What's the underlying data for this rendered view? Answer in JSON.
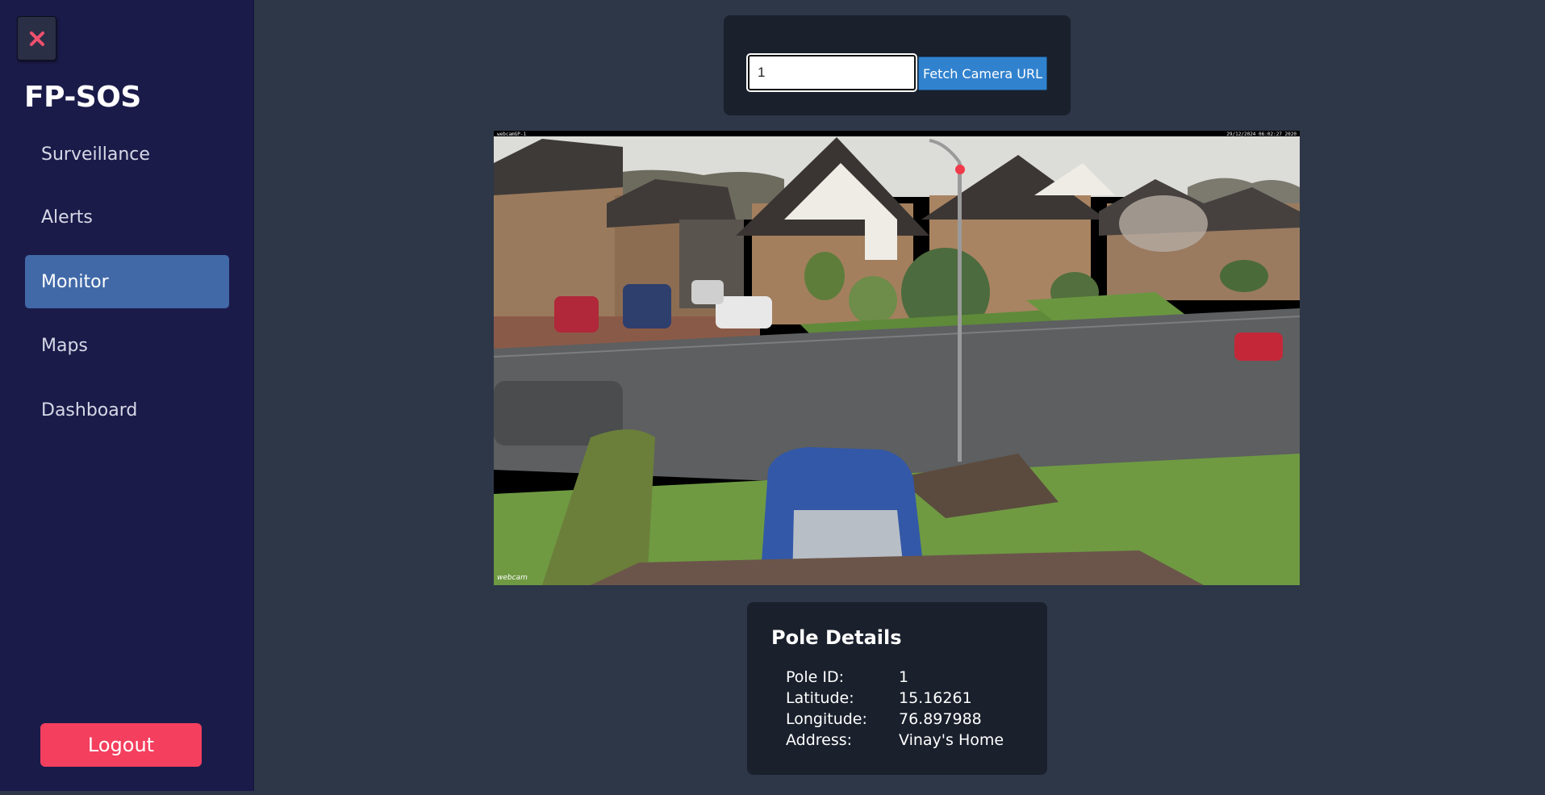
{
  "sidebar": {
    "close_icon": "close-icon",
    "brand": "FP-SOS",
    "items": [
      {
        "label": "Surveillance",
        "active": false
      },
      {
        "label": "Alerts",
        "active": false
      },
      {
        "label": "Monitor",
        "active": true
      },
      {
        "label": "Maps",
        "active": false
      },
      {
        "label": "Dashboard",
        "active": false
      }
    ],
    "logout_label": "Logout"
  },
  "fetch": {
    "input_value": "1",
    "button_label": "Fetch Camera URL"
  },
  "camera": {
    "osd_left": "webcamGP-1",
    "osd_right": "29/12/2024 06:02:27 2020",
    "watermark": "webcam"
  },
  "details": {
    "title": "Pole Details",
    "rows": [
      {
        "key": "Pole ID:",
        "value": "1"
      },
      {
        "key": "Latitude:",
        "value": "15.16261"
      },
      {
        "key": "Longitude:",
        "value": "76.897988"
      },
      {
        "key": "Address:",
        "value": "Vinay's Home"
      }
    ]
  },
  "colors": {
    "background": "#2d3748",
    "sidebar": "#1b1b4a",
    "active_nav": "#4169a8",
    "logout": "#f43f5e",
    "button": "#3182ce",
    "card": "#1a202c"
  }
}
